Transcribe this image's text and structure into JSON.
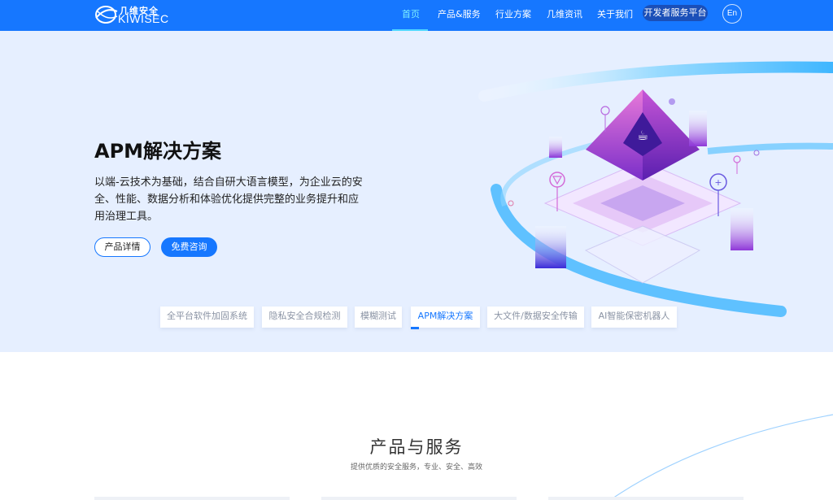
{
  "header": {
    "logo_cn": "几维安全",
    "logo_en": "KIWISEC",
    "nav": [
      {
        "label": "首页",
        "active": true
      },
      {
        "label": "产品&服务",
        "active": false
      },
      {
        "label": "行业方案",
        "active": false
      },
      {
        "label": "几维资讯",
        "active": false
      },
      {
        "label": "关于我们",
        "active": false
      }
    ],
    "dev_platform": "开发者服务平台",
    "lang": "En"
  },
  "hero": {
    "title": "APM解决方案",
    "description": "以端-云技术为基础，结合自研大语言模型，为企业云的安全、性能、数据分析和体验优化提供完整的业务提升和应用治理工具。",
    "btn_detail": "产品详情",
    "btn_consult": "免费咨询",
    "tabs": [
      {
        "label": "全平台软件加固系统",
        "active": false
      },
      {
        "label": "隐私安全合规检测",
        "active": false
      },
      {
        "label": "模糊测试",
        "active": false
      },
      {
        "label": "APM解决方案",
        "active": true
      },
      {
        "label": "大文件/数据安全传输",
        "active": false
      },
      {
        "label": "AI智能保密机器人",
        "active": false
      }
    ]
  },
  "products": {
    "title": "产品与服务",
    "subtitle": "提供优质的安全服务，专业、安全、高效"
  },
  "colors": {
    "primary": "#1677ff",
    "hero_bg": "#e6efff",
    "nav_active": "#7ef0ff"
  }
}
